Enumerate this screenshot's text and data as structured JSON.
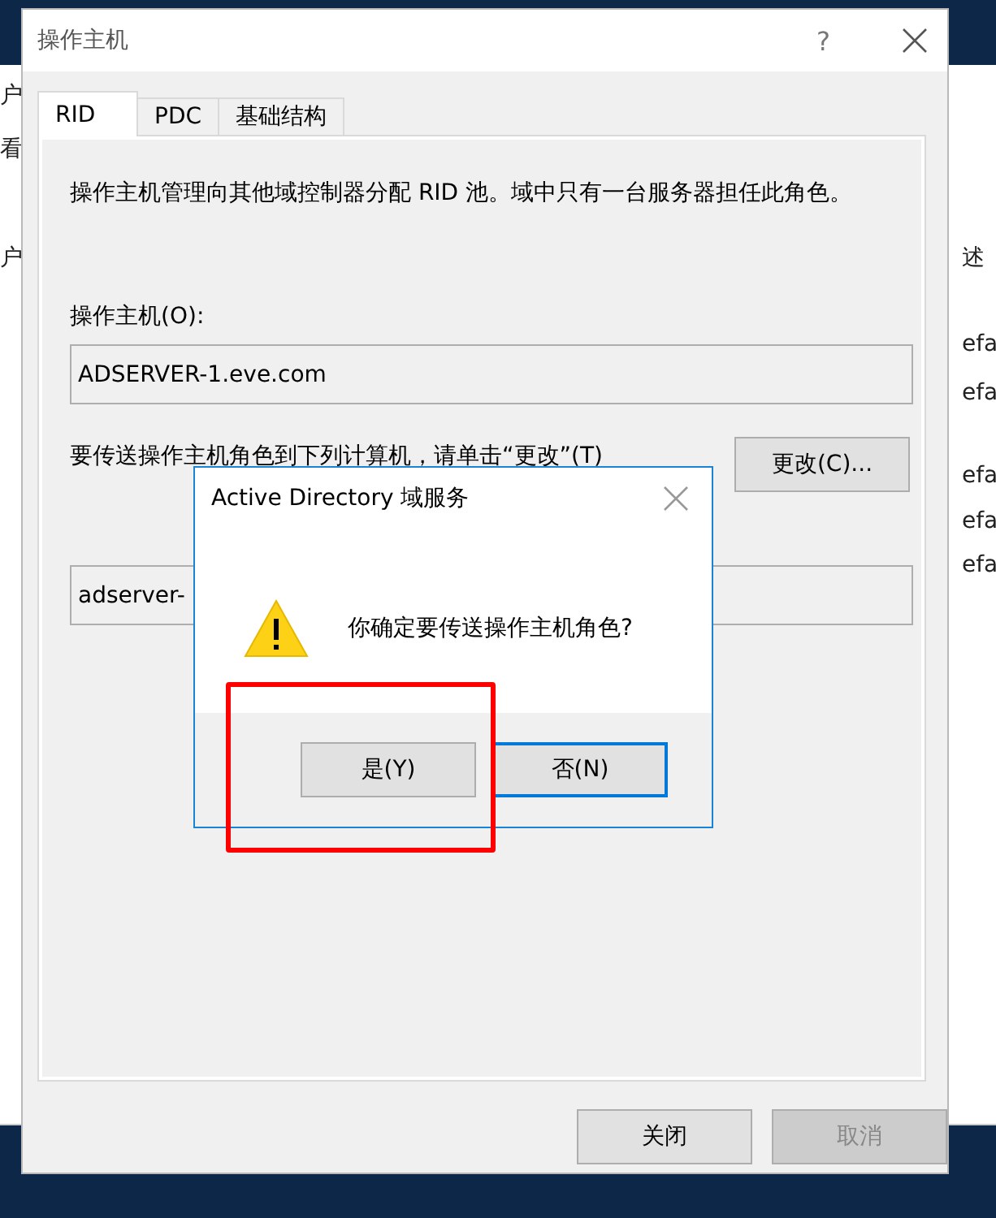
{
  "background_window": {
    "left_texts": [
      "户",
      "看",
      "户"
    ],
    "right_texts": [
      "述",
      "efa",
      "efa",
      "efa",
      "efa",
      "efa"
    ]
  },
  "dialog": {
    "title": "操作主机",
    "help": "?",
    "tabs": [
      {
        "label": "RID",
        "selected": true
      },
      {
        "label": "PDC",
        "selected": false
      },
      {
        "label": "基础结构",
        "selected": false
      }
    ],
    "description": "操作主机管理向其他域控制器分配 RID 池。域中只有一台服务器担任此角色。",
    "master_label": "操作主机(O):",
    "master_value": "ADSERVER-1.eve.com",
    "transfer_text": "要传送操作主机角色到下列计算机，请单击“更改”(T)",
    "change_button": "更改(C)...",
    "target_value": "adserver-",
    "buttons": [
      {
        "label": "关闭",
        "disabled": false
      },
      {
        "label": "取消",
        "disabled": true
      }
    ]
  },
  "message_box": {
    "title": "Active Directory 域服务",
    "message": "你确定要传送操作主机角色?",
    "buttons": [
      {
        "label": "是(Y)",
        "focused": false
      },
      {
        "label": "否(N)",
        "focused": true
      }
    ]
  },
  "highlight": {
    "shown": true
  }
}
